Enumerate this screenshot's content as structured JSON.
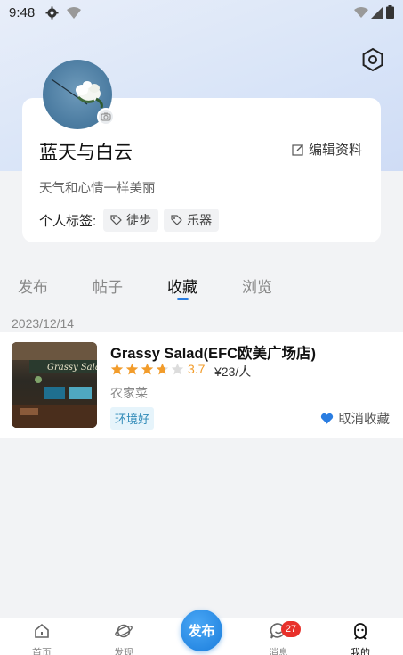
{
  "status_bar": {
    "time": "9:48"
  },
  "profile": {
    "username": "蓝天与白云",
    "edit_label": "编辑资料",
    "bio": "天气和心情一样美丽",
    "tags_label": "个人标签:",
    "tags": [
      "徒步",
      "乐器"
    ]
  },
  "tabs": [
    {
      "label": "发布"
    },
    {
      "label": "帖子"
    },
    {
      "label": "收藏"
    },
    {
      "label": "浏览"
    }
  ],
  "active_tab": "收藏",
  "favorites": {
    "date": "2023/12/14",
    "item": {
      "title": "Grassy Salad(EFC欧美广场店)",
      "rating": "3.7",
      "rating_value": 3.7,
      "price": "¥23/人",
      "category": "农家菜",
      "tag": "环境好",
      "unfav_label": "取消收藏",
      "thumb_sign": "Grassy Salad"
    }
  },
  "bottom_nav": {
    "items": [
      {
        "label": "首页",
        "icon": "home-icon"
      },
      {
        "label": "发现",
        "icon": "planet-icon"
      },
      {
        "label": "消息",
        "icon": "message-icon"
      },
      {
        "label": "我的",
        "icon": "profile-icon"
      }
    ],
    "publish_label": "发布",
    "message_badge": "27"
  },
  "colors": {
    "accent": "#2a7de1",
    "star": "#f29c2b",
    "badge": "#e8312b",
    "tag_bg": "#e6f4fb"
  }
}
